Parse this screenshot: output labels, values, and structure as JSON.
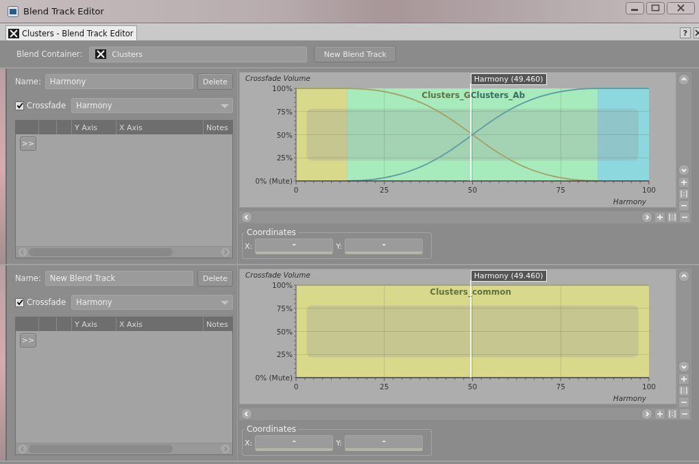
{
  "window": {
    "title": "Blend Track Editor"
  },
  "tab": {
    "label": "Clusters - Blend Track Editor",
    "selected": true
  },
  "help_button": "?",
  "blend_container": {
    "label": "Blend Container:",
    "value": "Clusters"
  },
  "new_track_button": "New Blend Track",
  "tracks": [
    {
      "name_label": "Name:",
      "name": "Harmony",
      "delete_button": "Delete",
      "crossfade": {
        "label": "Crossfade",
        "checked": true
      },
      "parameter": "Harmony",
      "table": {
        "columns": [
          "Y Axis",
          "X Axis",
          "Notes"
        ],
        "expand_button": ">>"
      },
      "chart_data": {
        "type": "line",
        "ylabel": "Crossfade Volume",
        "xlabel": "Harmony",
        "x": [
          0,
          14.5,
          85.5,
          100
        ],
        "series": [
          {
            "name": "Clusters_G",
            "color": "#a3a36a",
            "values": [
              100,
              100,
              0,
              null
            ]
          },
          {
            "name": "Clusters_Ab",
            "color": "#5f9ea3",
            "values": [
              null,
              0,
              100,
              100
            ]
          }
        ],
        "bands": [
          {
            "axis": "x",
            "from": 0,
            "to": 14.5,
            "color": "#d9d98c"
          },
          {
            "axis": "x",
            "from": 14.5,
            "to": 85.5,
            "color": "#a7ebbd"
          },
          {
            "axis": "x",
            "from": 85.5,
            "to": 100,
            "color": "#8cd8de"
          }
        ],
        "ref_lines": [
          {
            "axis": "x",
            "value": 49.46
          }
        ],
        "grid": true,
        "xlim": [
          0,
          100
        ],
        "ylim": [
          0,
          100
        ],
        "xticks": [
          0,
          25,
          50,
          75,
          100
        ],
        "yticks": [
          {
            "value": 0,
            "label": "0% (Mute)"
          },
          {
            "value": 25,
            "label": "25%"
          },
          {
            "value": 50,
            "label": "50%"
          },
          {
            "value": 75,
            "label": "75%"
          },
          {
            "value": 100,
            "label": "100%"
          }
        ],
        "annotations": [
          "Harmony (49.460)"
        ]
      },
      "coordinates": {
        "title": "Coordinates",
        "x_label": "X:",
        "x_value": "-",
        "y_label": "Y:",
        "y_value": "-"
      }
    },
    {
      "name_label": "Name:",
      "name": "New Blend Track",
      "delete_button": "Delete",
      "crossfade": {
        "label": "Crossfade",
        "checked": true
      },
      "parameter": "Harmony",
      "table": {
        "columns": [
          "Y Axis",
          "X Axis",
          "Notes"
        ],
        "expand_button": ">>"
      },
      "chart_data": {
        "type": "line",
        "ylabel": "Crossfade Volume",
        "xlabel": "Harmony",
        "x": [
          0,
          100
        ],
        "series": [
          {
            "name": "Clusters_common",
            "color": "#a3a36a",
            "values": [
              100,
              100
            ]
          }
        ],
        "bands": [
          {
            "axis": "x",
            "from": 0,
            "to": 100,
            "color": "#d9d98c"
          }
        ],
        "ref_lines": [
          {
            "axis": "x",
            "value": 49.46
          }
        ],
        "grid": true,
        "xlim": [
          0,
          100
        ],
        "ylim": [
          0,
          100
        ],
        "xticks": [
          0,
          25,
          50,
          75,
          100
        ],
        "yticks": [
          {
            "value": 0,
            "label": "0% (Mute)"
          },
          {
            "value": 25,
            "label": "25%"
          },
          {
            "value": 50,
            "label": "50%"
          },
          {
            "value": 75,
            "label": "75%"
          },
          {
            "value": 100,
            "label": "100%"
          }
        ],
        "annotations": [
          "Harmony (49.460)"
        ]
      },
      "coordinates": {
        "title": "Coordinates",
        "x_label": "X:",
        "x_value": "-",
        "y_label": "Y:",
        "y_value": "-"
      }
    }
  ]
}
